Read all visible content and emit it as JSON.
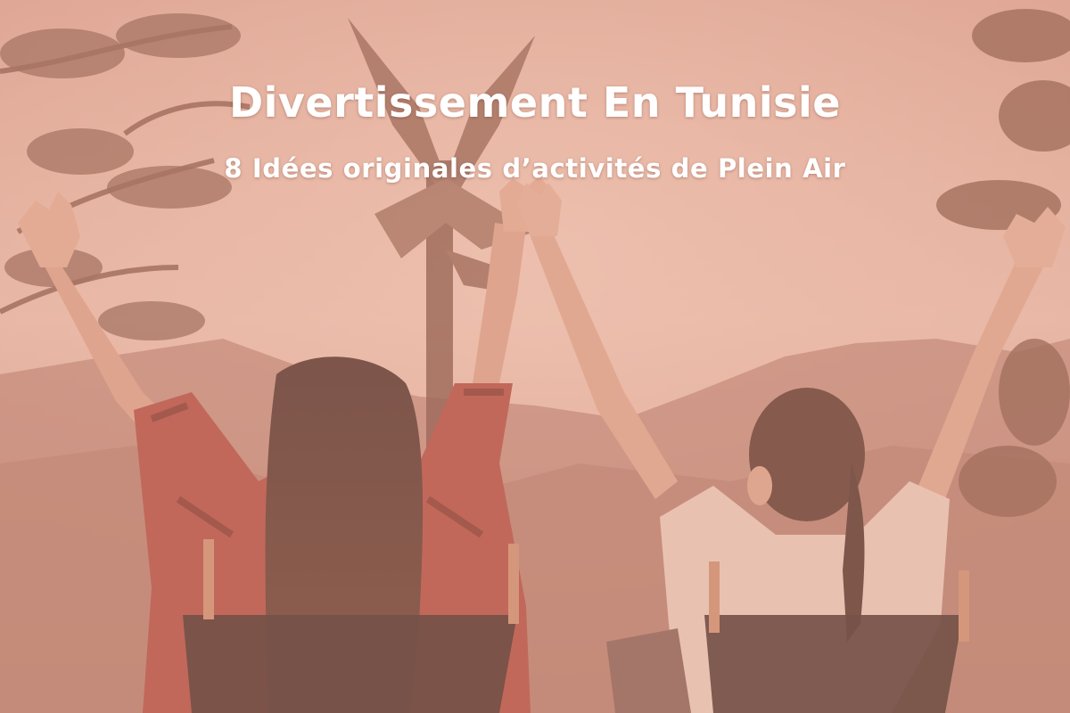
{
  "banner": {
    "title": "Divertissement En Tunisie",
    "subtitle": "8 Idées originales d’activités de Plein Air"
  },
  "colors": {
    "overlay_tint": "#e9a590",
    "sky": "#e3b8a8",
    "text": "#ffffff"
  }
}
